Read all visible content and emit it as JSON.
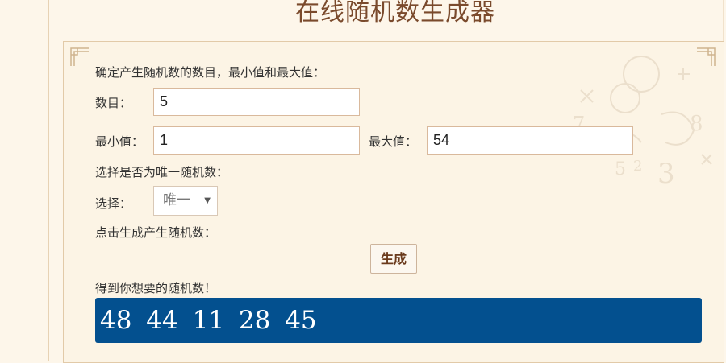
{
  "page": {
    "title": "在线随机数生成器"
  },
  "form": {
    "instruction": "确定产生随机数的数目，最小值和最大值：",
    "count_label": "数目：",
    "count_value": "5",
    "min_label": "最小值：",
    "min_value": "1",
    "max_label": "最大值：",
    "max_value": "54",
    "unique_instruction": "选择是否为唯一随机数：",
    "select_label": "选择：",
    "select_value": "唯一",
    "generate_instruction": "点击生成产生随机数：",
    "generate_button": "生成",
    "result_label": "得到你想要的随机数！",
    "result_value": "48  44  11  28  45"
  },
  "colors": {
    "background": "#fdf6ea",
    "title": "#7a4a2c",
    "result_bg": "#03508f",
    "button_text": "#6a3a1c"
  },
  "icons": {
    "dropdown": "triangle-down-icon",
    "corner": "ornament-corner-icon",
    "decoration": "numbers-background-decoration"
  }
}
